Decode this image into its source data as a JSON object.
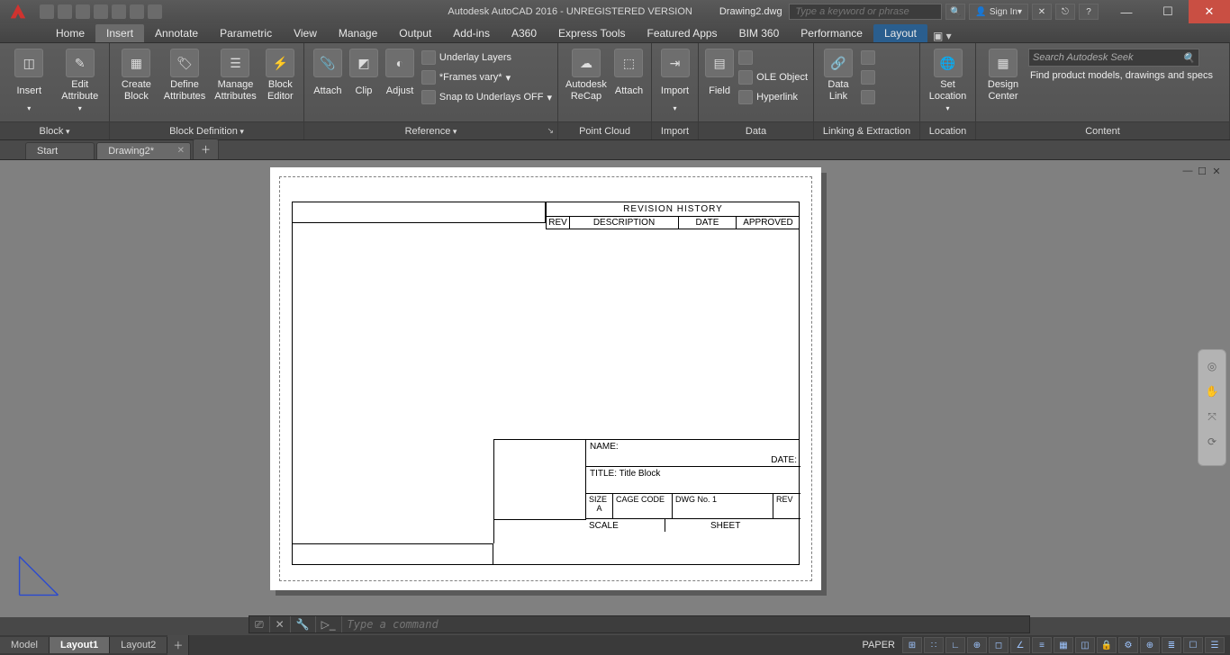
{
  "title": {
    "app": "Autodesk AutoCAD 2016 - UNREGISTERED VERSION",
    "doc": "Drawing2.dwg"
  },
  "search": {
    "placeholder": "Type a keyword or phrase",
    "sign_in": "Sign In"
  },
  "tabs": [
    "Home",
    "Insert",
    "Annotate",
    "Parametric",
    "View",
    "Manage",
    "Output",
    "Add-ins",
    "A360",
    "Express Tools",
    "Featured Apps",
    "BIM 360",
    "Performance",
    "Layout"
  ],
  "active_tab": "Insert",
  "ribbon": {
    "block": {
      "title": "Block",
      "insert": "Insert",
      "edit_attr": "Edit\nAttribute"
    },
    "blockdef": {
      "title": "Block Definition",
      "create": "Create\nBlock",
      "define": "Define\nAttributes",
      "manage": "Manage\nAttributes",
      "editor": "Block\nEditor"
    },
    "reference": {
      "title": "Reference",
      "attach": "Attach",
      "clip": "Clip",
      "adjust": "Adjust",
      "underlay": "Underlay Layers",
      "frames": "*Frames vary*",
      "snap": "Snap to Underlays OFF"
    },
    "pointcloud": {
      "title": "Point Cloud",
      "recap": "Autodesk\nReCap",
      "attach": "Attach"
    },
    "import": {
      "title": "Import",
      "import": "Import"
    },
    "data": {
      "title": "Data",
      "field": "Field",
      "ole": "OLE Object",
      "hyper": "Hyperlink"
    },
    "linking": {
      "title": "Linking & Extraction",
      "datalink": "Data\nLink"
    },
    "location": {
      "title": "Location",
      "set": "Set\nLocation"
    },
    "content": {
      "title": "Content",
      "design": "Design\nCenter",
      "search_ph": "Search Autodesk Seek",
      "tag": "Find product models, drawings and specs"
    }
  },
  "filetabs": {
    "start": "Start",
    "current": "Drawing2*"
  },
  "sheet": {
    "rev_title": "REVISION  HISTORY",
    "rev_cols": {
      "rev": "REV",
      "desc": "DESCRIPTION",
      "date": "DATE",
      "appr": "APPROVED"
    },
    "name": "NAME:",
    "date": "DATE:",
    "title_lbl": "TITLE:",
    "title_val": "Title Block",
    "size_lbl": "SIZE",
    "size_val": "A",
    "cage": "CAGE  CODE",
    "dwg": "DWG  No.  1",
    "rev": "REV",
    "scale": "SCALE",
    "sheet_lbl": "SHEET"
  },
  "cmd": {
    "placeholder": "Type a command"
  },
  "bottom_tabs": [
    "Model",
    "Layout1",
    "Layout2"
  ],
  "active_bottom": "Layout1",
  "status": {
    "paper": "PAPER"
  }
}
